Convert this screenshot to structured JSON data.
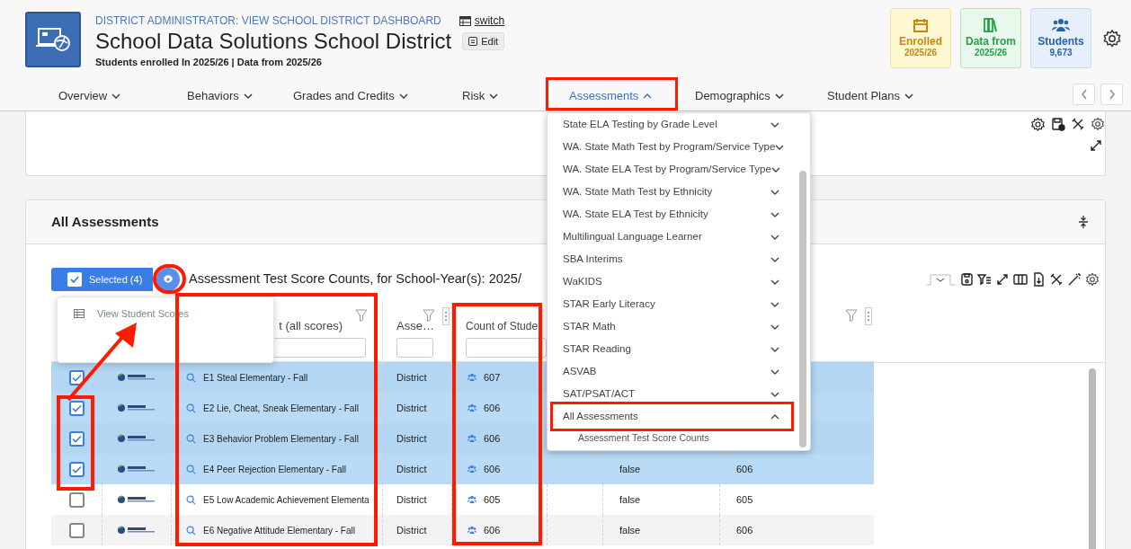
{
  "header": {
    "role_link": "DISTRICT ADMINISTRATOR: VIEW SCHOOL DISTRICT DASHBOARD",
    "switch_link": "switch",
    "title": "School Data Solutions School District",
    "edit_button": "Edit",
    "subtitle": "Students enrolled In 2025/26 | Data from 2025/26"
  },
  "stat_cards": [
    {
      "kind": "enrolled",
      "label": "Enrolled",
      "value": "2025/26"
    },
    {
      "kind": "data_from",
      "label": "Data from",
      "value": "2025/26"
    },
    {
      "kind": "students",
      "label": "Students",
      "value": "9,673"
    }
  ],
  "nav": [
    {
      "label": "Overview",
      "selected": false,
      "expanded": false
    },
    {
      "label": "Behaviors",
      "selected": false,
      "expanded": false
    },
    {
      "label": "Grades and Credits",
      "selected": false,
      "expanded": false
    },
    {
      "label": "Risk",
      "selected": false,
      "expanded": false
    },
    {
      "label": "Assessments",
      "selected": true,
      "expanded": true
    },
    {
      "label": "Demographics",
      "selected": false,
      "expanded": false
    },
    {
      "label": "Student Plans",
      "selected": false,
      "expanded": false
    }
  ],
  "assessments_menu": [
    {
      "label": "State ELA Testing by Grade Level",
      "expanded": false
    },
    {
      "label": "WA. State Math Test by Program/Service Type",
      "expanded": false
    },
    {
      "label": "WA. State ELA Test by Program/Service Type",
      "expanded": false
    },
    {
      "label": "WA. State Math Test by Ethnicity",
      "expanded": false
    },
    {
      "label": "WA. State ELA Test by Ethnicity",
      "expanded": false
    },
    {
      "label": "Multilingual Language Learner",
      "expanded": false
    },
    {
      "label": "SBA Interims",
      "expanded": false
    },
    {
      "label": "WaKIDS",
      "expanded": false
    },
    {
      "label": "STAR Early Literacy",
      "expanded": false
    },
    {
      "label": "STAR Math",
      "expanded": false
    },
    {
      "label": "STAR Reading",
      "expanded": false
    },
    {
      "label": "ASVAB",
      "expanded": false
    },
    {
      "label": "SAT/PSAT/ACT",
      "expanded": false
    },
    {
      "label": "All Assessments",
      "expanded": true,
      "children": [
        {
          "label": "Assessment Test Score Counts"
        }
      ]
    }
  ],
  "section": {
    "title": "All Assessments"
  },
  "toolbar": {
    "selected_button": "Selected (4)",
    "report_title": "Assessment Test Score Counts, for School-Year(s): 2025/"
  },
  "selection_menu": [
    "View Student Scores"
  ],
  "table": {
    "columns": [
      "t (all scores)",
      "Asse…",
      "Count of Stude"
    ],
    "rows": [
      {
        "selected": true,
        "name": "E1 Steal Elementary - Fall",
        "level": "District",
        "count": "607"
      },
      {
        "selected": true,
        "name": "E2 Lie, Cheat, Sneak Elementary - Fall",
        "level": "District",
        "count": "606"
      },
      {
        "selected": true,
        "name": "E3 Behavior Problem Elementary - Fall",
        "level": "District",
        "count": "606"
      },
      {
        "selected": true,
        "name": "E4 Peer Rejection Elementary - Fall",
        "level": "District",
        "count": "606",
        "column_7": "false",
        "column_8": "606"
      },
      {
        "selected": false,
        "name": "E5 Low Academic Achievement Elementa",
        "level": "District",
        "count": "605",
        "column_7": "false",
        "column_8": "605"
      },
      {
        "selected": false,
        "name": "E6 Negative Attitude Elementary - Fall",
        "level": "District",
        "count": "606",
        "column_7": "false",
        "column_8": "606"
      }
    ]
  }
}
